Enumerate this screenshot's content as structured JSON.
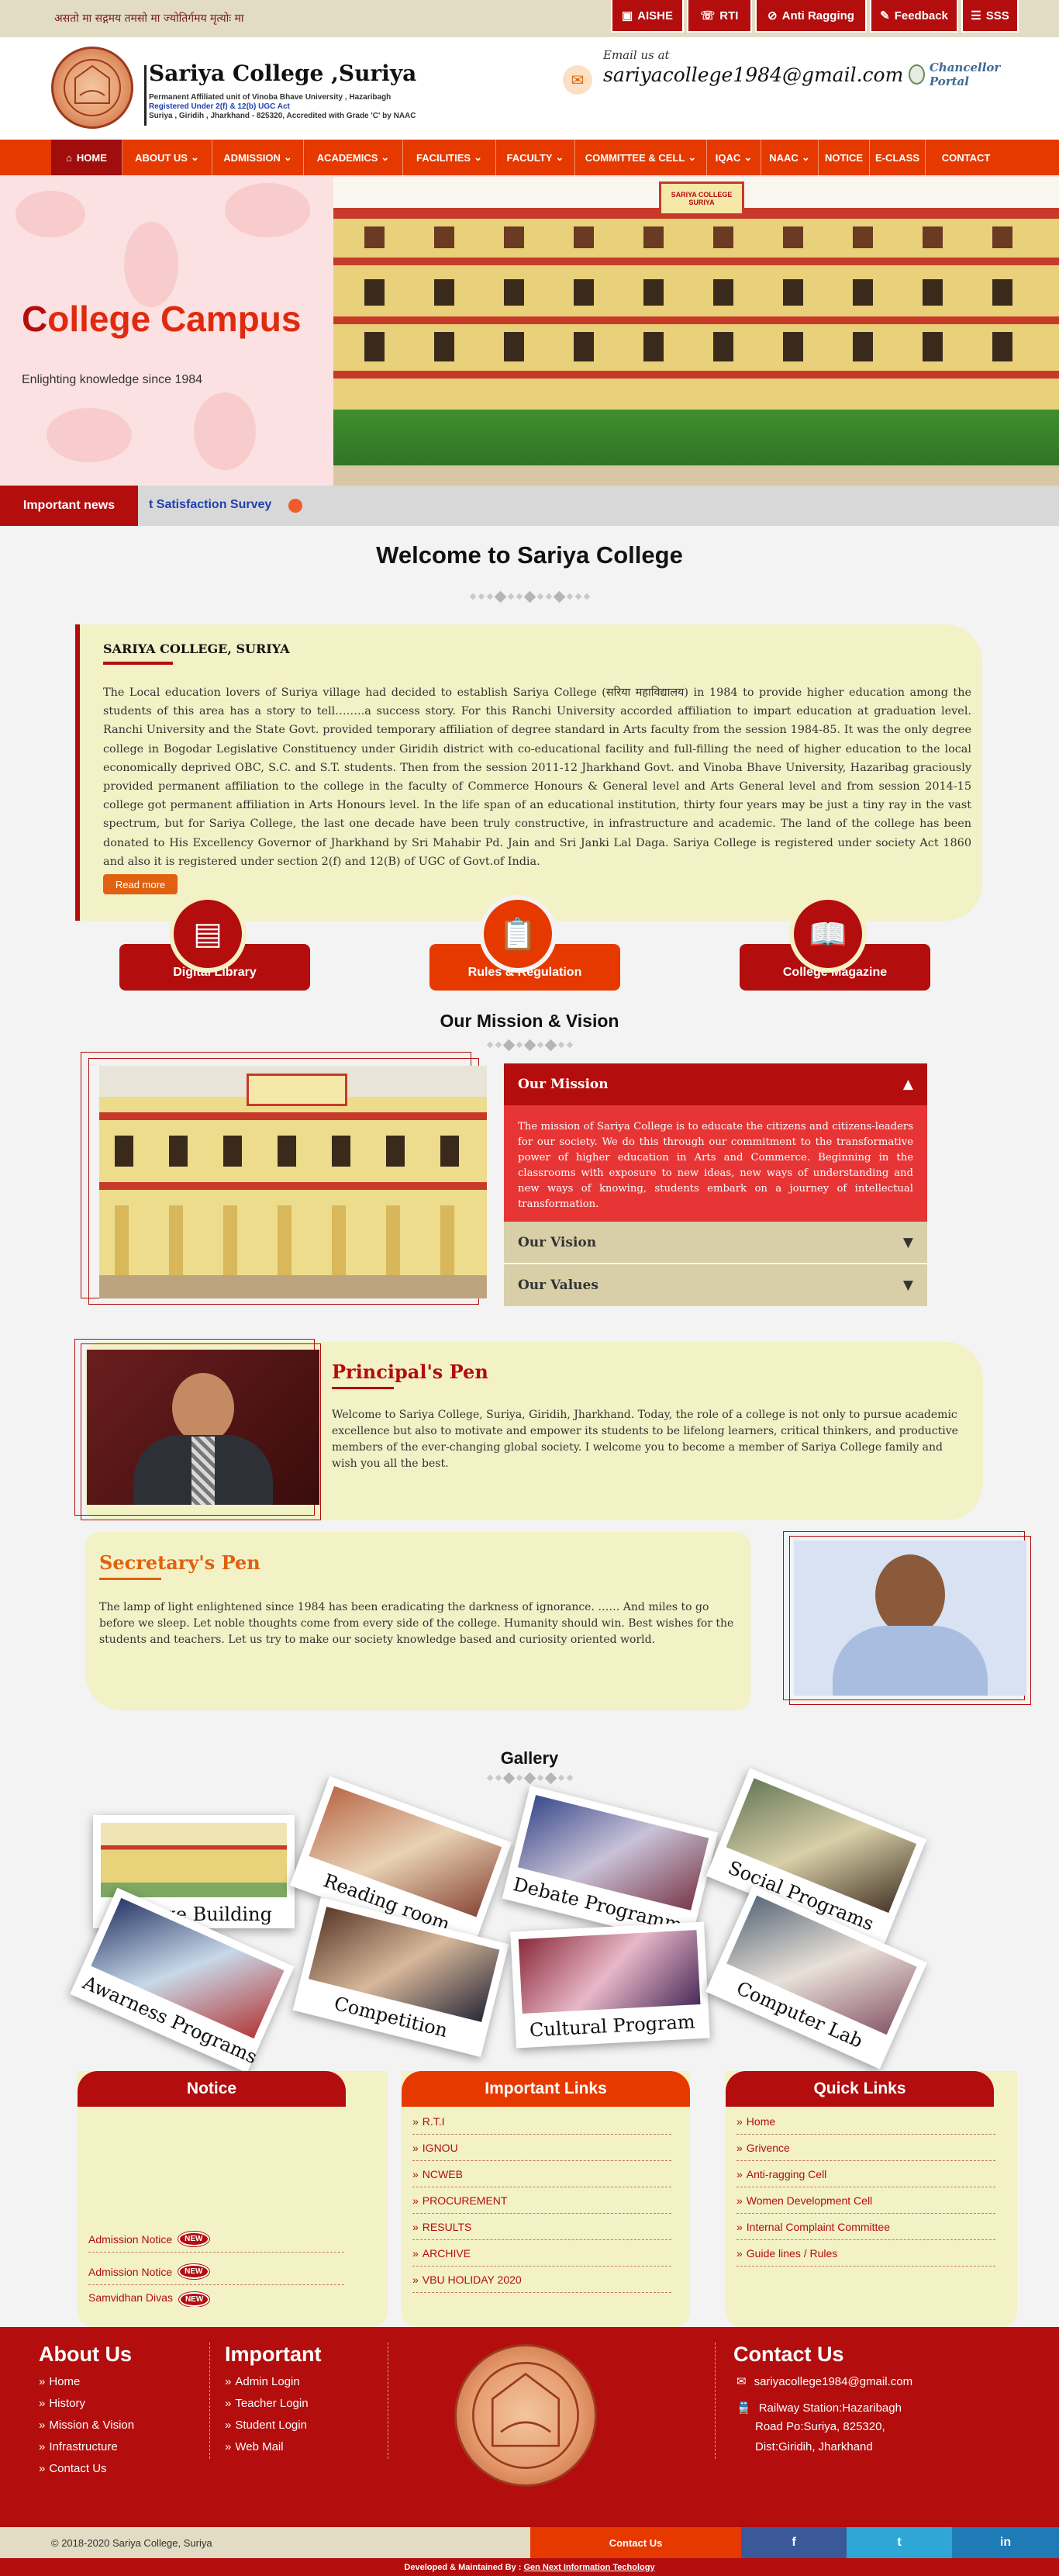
{
  "topbar": {
    "motto": "असतो मा सद्गमय तमसो मा ज्योतिर्गमय मृत्योः मा",
    "buttons": [
      "AISHE",
      "RTI",
      "Anti Ragging",
      "Feedback",
      "SSS"
    ]
  },
  "header": {
    "title": "Sariya College ,Suriya",
    "sub1": "Permanent Affiliated unit of Vinoba Bhave University , Hazaribagh",
    "sub2": "Registered Under 2(f) & 12(b) UGC Act",
    "sub3": "Suriya , Giridih , Jharkhand - 825320, Accredited with Grade 'C' by NAAC",
    "email_label": "Email us at",
    "email": "sariyacollege1984@gmail.com",
    "chancellor": "Chancellor Portal",
    "seal_text": "SARIYA COLLEGE"
  },
  "nav": {
    "items": [
      "HOME",
      "ABOUT US",
      "ADMISSION",
      "ACADEMICS",
      "FACILITIES",
      "FACULTY",
      "COMMITTEE & CELL",
      "IQAC",
      "NAAC",
      "NOTICE",
      "E-CLASS",
      "CONTACT"
    ]
  },
  "hero": {
    "title_first": "C",
    "title_rest": "ollege Campus",
    "subtitle": "Enlighting knowledge since 1984",
    "sign": "SARIYA COLLEGE SURIYA"
  },
  "news": {
    "label": "Important news",
    "ticker": "t Satisfaction Survey"
  },
  "welcome": {
    "title": "Welcome to Sariya College"
  },
  "about": {
    "heading": "SARIYA COLLEGE, SURIYA",
    "body": "The Local education lovers of Suriya village had decided to establish Sariya College (सरिया महाविद्यालय) in 1984 to provide higher education among the students of this area has a story to tell……..a success story. For this Ranchi University accorded affiliation to impart education at graduation level. Ranchi University and the State Govt. provided temporary affiliation of degree standard in Arts faculty from the session 1984-85. It was the only degree college in Bogodar Legislative Constituency under Giridih district with co-educational facility and full-filling the need of higher education to the local economically deprived OBC, S.C. and S.T. students. Then from the session 2011-12 Jharkhand Govt. and Vinoba Bhave University, Hazaribag graciously provided permanent affiliation to the college in the faculty of Commerce Honours & General level and Arts General level and from session 2014-15 college got permanent affiliation in Arts Honours level. In the life span of an educational institution, thirty four years may be just a tiny ray in the vast spectrum, but for Sariya College, the last one decade have been truly constructive, in infrastructure and academic. The land of the college has been donated to His Excellency Governor of Jharkhand by Sri Mahabir Pd. Jain and Sri Janki Lal Daga. Sariya College is registered under society Act 1860 and also it is registered under section 2(f) and 12(B) of UGC of Govt.of India.",
    "read_more": "Read more"
  },
  "cards": [
    {
      "label": "Digital Library",
      "icon": "book-screen-icon"
    },
    {
      "label": "Rules & Regulation",
      "icon": "clipboard-icon"
    },
    {
      "label": "College Magazine",
      "icon": "open-book-icon"
    }
  ],
  "mission": {
    "title": "Our Mission & Vision",
    "acc1": "Our Mission",
    "acc1_body": "The mission of Sariya College is to educate the citizens and citizens-leaders for our society. We do this through our commitment to the transformative power of higher education in Arts and Commerce. Beginning in the classrooms with exposure to new ideas, new ways of understanding and new ways of knowing, students embark on a journey of intellectual transformation.",
    "acc2": "Our Vision",
    "acc3": "Our Values",
    "arrow_up": "▲",
    "arrow_down": "▼"
  },
  "principal": {
    "title": "Principal's Pen",
    "body": "Welcome to Sariya College, Suriya, Giridih, Jharkhand. Today, the role of a college is not only to pursue academic excellence but also to motivate and empower its students to be lifelong learners, critical thinkers, and productive members of the ever-changing global society. I welcome you to become a member of Sariya College family and wish you all the best."
  },
  "secretary": {
    "title": "Secretary's Pen",
    "body": "The lamp of light enlightened since 1984 has been eradicating the darkness of ignorance. …… And miles to go before we sleep. Let noble thoughts come from every side of the college. Humanity should win. Best wishes for the students and teachers. Let us try to make our society knowledge based and curiosity oriented world."
  },
  "gallery": {
    "title": "Gallery",
    "items": [
      "College Building",
      "Reading room",
      "Debate Programme",
      "Social Programs",
      "Awarness Programs",
      "Competition",
      "Cultural Program",
      "Computer Lab"
    ]
  },
  "notice": {
    "title": "Notice",
    "items": [
      "Admission Notice",
      "Admission Notice",
      "Samvidhan Divas"
    ],
    "new": "NEW"
  },
  "links": {
    "title": "Important Links",
    "items": [
      "R.T.I",
      "IGNOU",
      "NCWEB",
      "PROCUREMENT",
      "RESULTS",
      "ARCHIVE",
      "VBU HOLIDAY 2020"
    ]
  },
  "quick": {
    "title": "Quick Links",
    "items": [
      "Home",
      "Grivence",
      "Anti-ragging Cell",
      "Women Development Cell",
      "Internal Complaint Committee",
      "Guide lines / Rules"
    ]
  },
  "footer": {
    "about_title": "About Us",
    "about_items": [
      "Home",
      "History",
      "Mission & Vision",
      "Infrastructure",
      "Contact Us"
    ],
    "imp_title": "Important",
    "imp_items": [
      "Admin Login",
      "Teacher Login",
      "Student Login",
      "Web Mail"
    ],
    "contact_title": "Contact Us",
    "email": "sariyacollege1984@gmail.com",
    "addr1": "Railway Station:Hazaribagh",
    "addr2": "Road Po:Suriya, 825320,",
    "addr3": "Dist:Giridih, Jharkhand"
  },
  "copy": {
    "text": "© 2018-2020 Sariya College, Suriya",
    "contact": "Contact Us",
    "fb": "f",
    "tw": "t",
    "li": "in"
  },
  "bottom": {
    "text": "Developed & Maintained By :",
    "link": "Gen Next Information Techology"
  },
  "colors": {
    "brand": "#b30d0d",
    "orange": "#e63900",
    "cream": "#f3f1c6"
  }
}
